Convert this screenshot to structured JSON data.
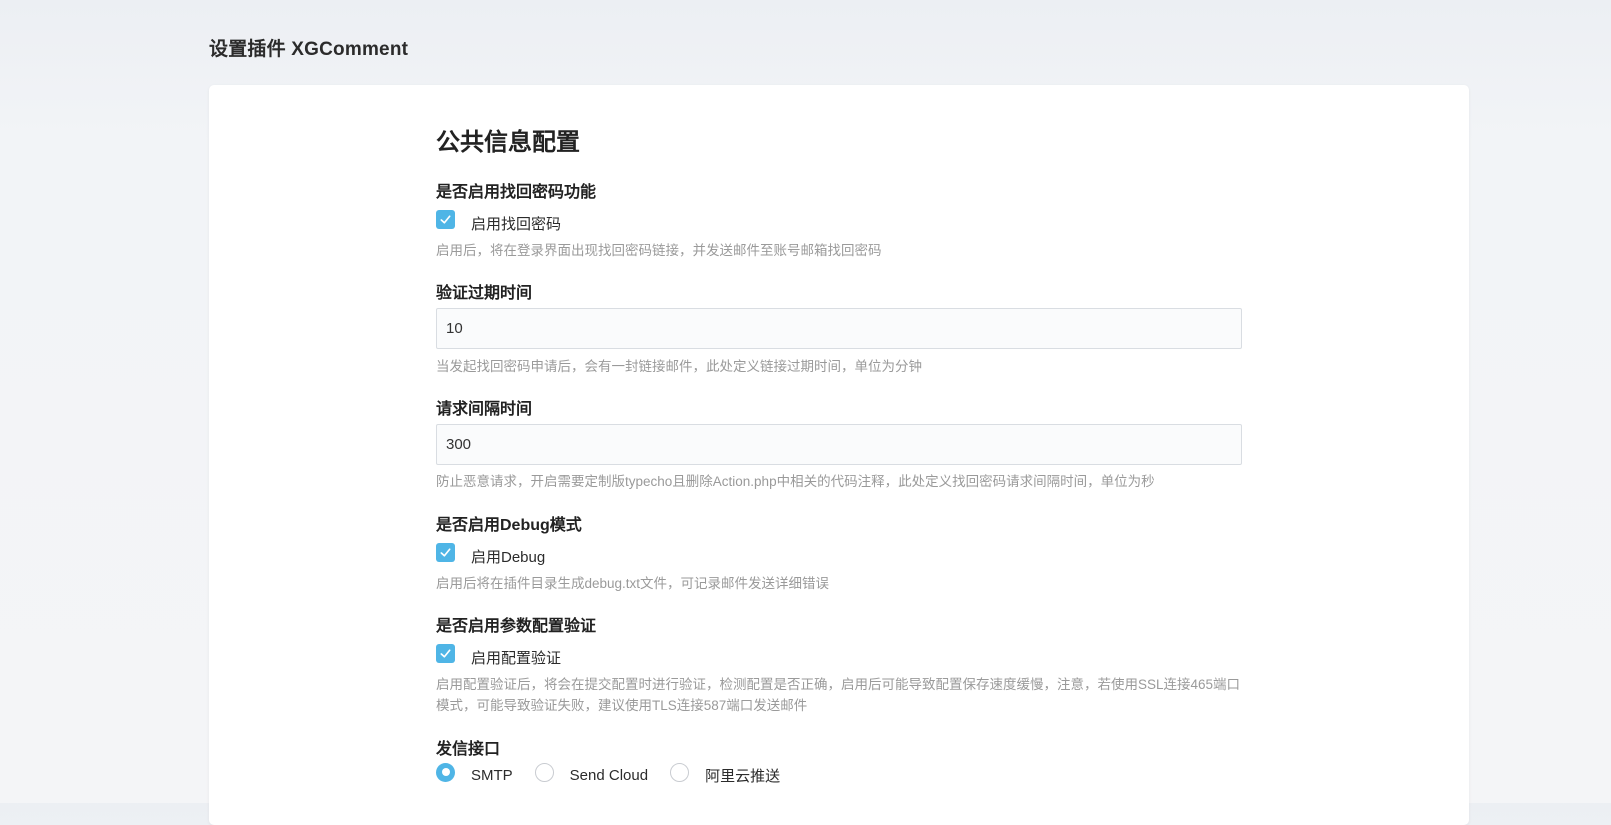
{
  "page_title": "设置插件 XGComment",
  "section_title": "公共信息配置",
  "fields": {
    "reset_password": {
      "label": "是否启用找回密码功能",
      "checkbox_label": "启用找回密码",
      "checked": true,
      "hint": "启用后，将在登录界面出现找回密码链接，并发送邮件至账号邮箱找回密码"
    },
    "expire_time": {
      "label": "验证过期时间",
      "value": "10",
      "hint": "当发起找回密码申请后，会有一封链接邮件，此处定义链接过期时间，单位为分钟"
    },
    "request_interval": {
      "label": "请求间隔时间",
      "value": "300",
      "hint": "防止恶意请求，开启需要定制版typecho且删除Action.php中相关的代码注释，此处定义找回密码请求间隔时间，单位为秒"
    },
    "debug": {
      "label": "是否启用Debug模式",
      "checkbox_label": "启用Debug",
      "checked": true,
      "hint": "启用后将在插件目录生成debug.txt文件，可记录邮件发送详细错误"
    },
    "config_validation": {
      "label": "是否启用参数配置验证",
      "checkbox_label": "启用配置验证",
      "checked": true,
      "hint": "启用配置验证后，将会在提交配置时进行验证，检测配置是否正确，启用后可能导致配置保存速度缓慢，注意，若使用SSL连接465端口模式，可能导致验证失败，建议使用TLS连接587端口发送邮件"
    },
    "mail_interface": {
      "label": "发信接口",
      "options": [
        {
          "label": "SMTP",
          "selected": true
        },
        {
          "label": "Send Cloud",
          "selected": false
        },
        {
          "label": "阿里云推送",
          "selected": false
        }
      ]
    }
  },
  "colors": {
    "accent": "#4fb5e6",
    "hint_text": "#9a9a9a",
    "background": "#f2f4f7",
    "card": "#ffffff"
  }
}
